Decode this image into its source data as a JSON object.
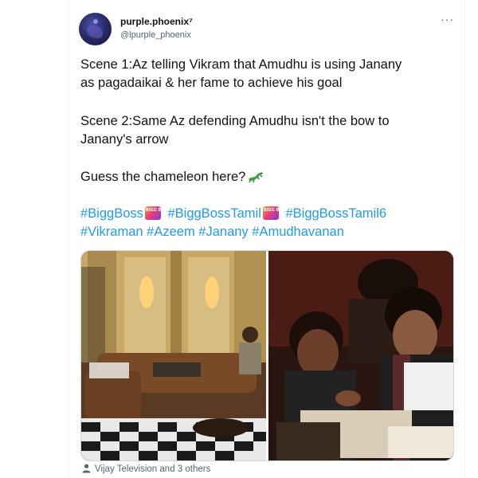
{
  "author": {
    "display_name": "purple.phoenix⁷",
    "handle": "@lpurple_phoenix",
    "more_label": "···"
  },
  "tweet": {
    "line1": "Scene 1:Az telling Vikram that Amudhu is using Janany",
    "line2": "as pagadaikai & her fame to achieve his goal",
    "line3": "Scene 2:Same Az defending Amudhu isn't the bow to",
    "line4": "Janany's arrow",
    "line5": "Guess the chameleon here?",
    "hashtags": {
      "h1": "#BiggBoss",
      "h2": "#BiggBossTamil",
      "h3": "#BiggBossTamil6",
      "h4": "#Vikraman",
      "h5": "#Azeem",
      "h6": "#Janany",
      "h7": "#Amudhavanan"
    },
    "emoji_icons": [
      "bigg-boss-emoji",
      "lizard-emoji"
    ]
  },
  "media": {
    "image_count": 2
  },
  "tagged": {
    "text": "Vijay Television and 3 others"
  },
  "colors": {
    "link": "#1d9bf0",
    "text": "#0f1419",
    "secondary": "#536471"
  }
}
